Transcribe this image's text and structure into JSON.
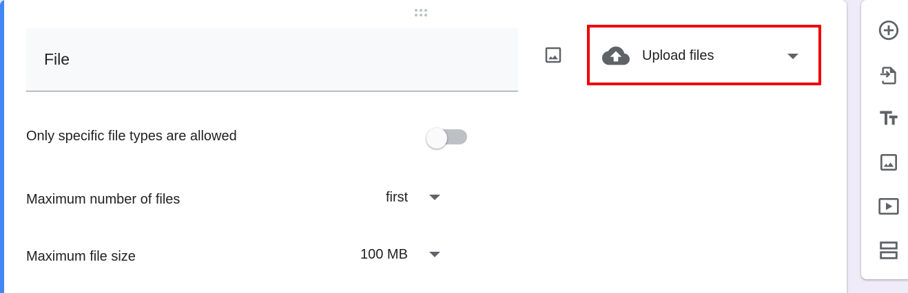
{
  "question": {
    "title": "File",
    "type_label": "Upload files",
    "accent_color": "#4285f4",
    "highlight_color": "#ee0000"
  },
  "settings": {
    "specific_types_label": "Only specific file types are allowed",
    "specific_types_enabled": false,
    "max_files_label": "Maximum number of files",
    "max_files_value": "first",
    "max_size_label": "Maximum file size",
    "max_size_value": "100 MB"
  },
  "toolbar": {
    "tools": [
      "add-circle-icon",
      "import-questions-icon",
      "title-text-icon",
      "image-icon",
      "video-icon",
      "section-icon"
    ]
  }
}
